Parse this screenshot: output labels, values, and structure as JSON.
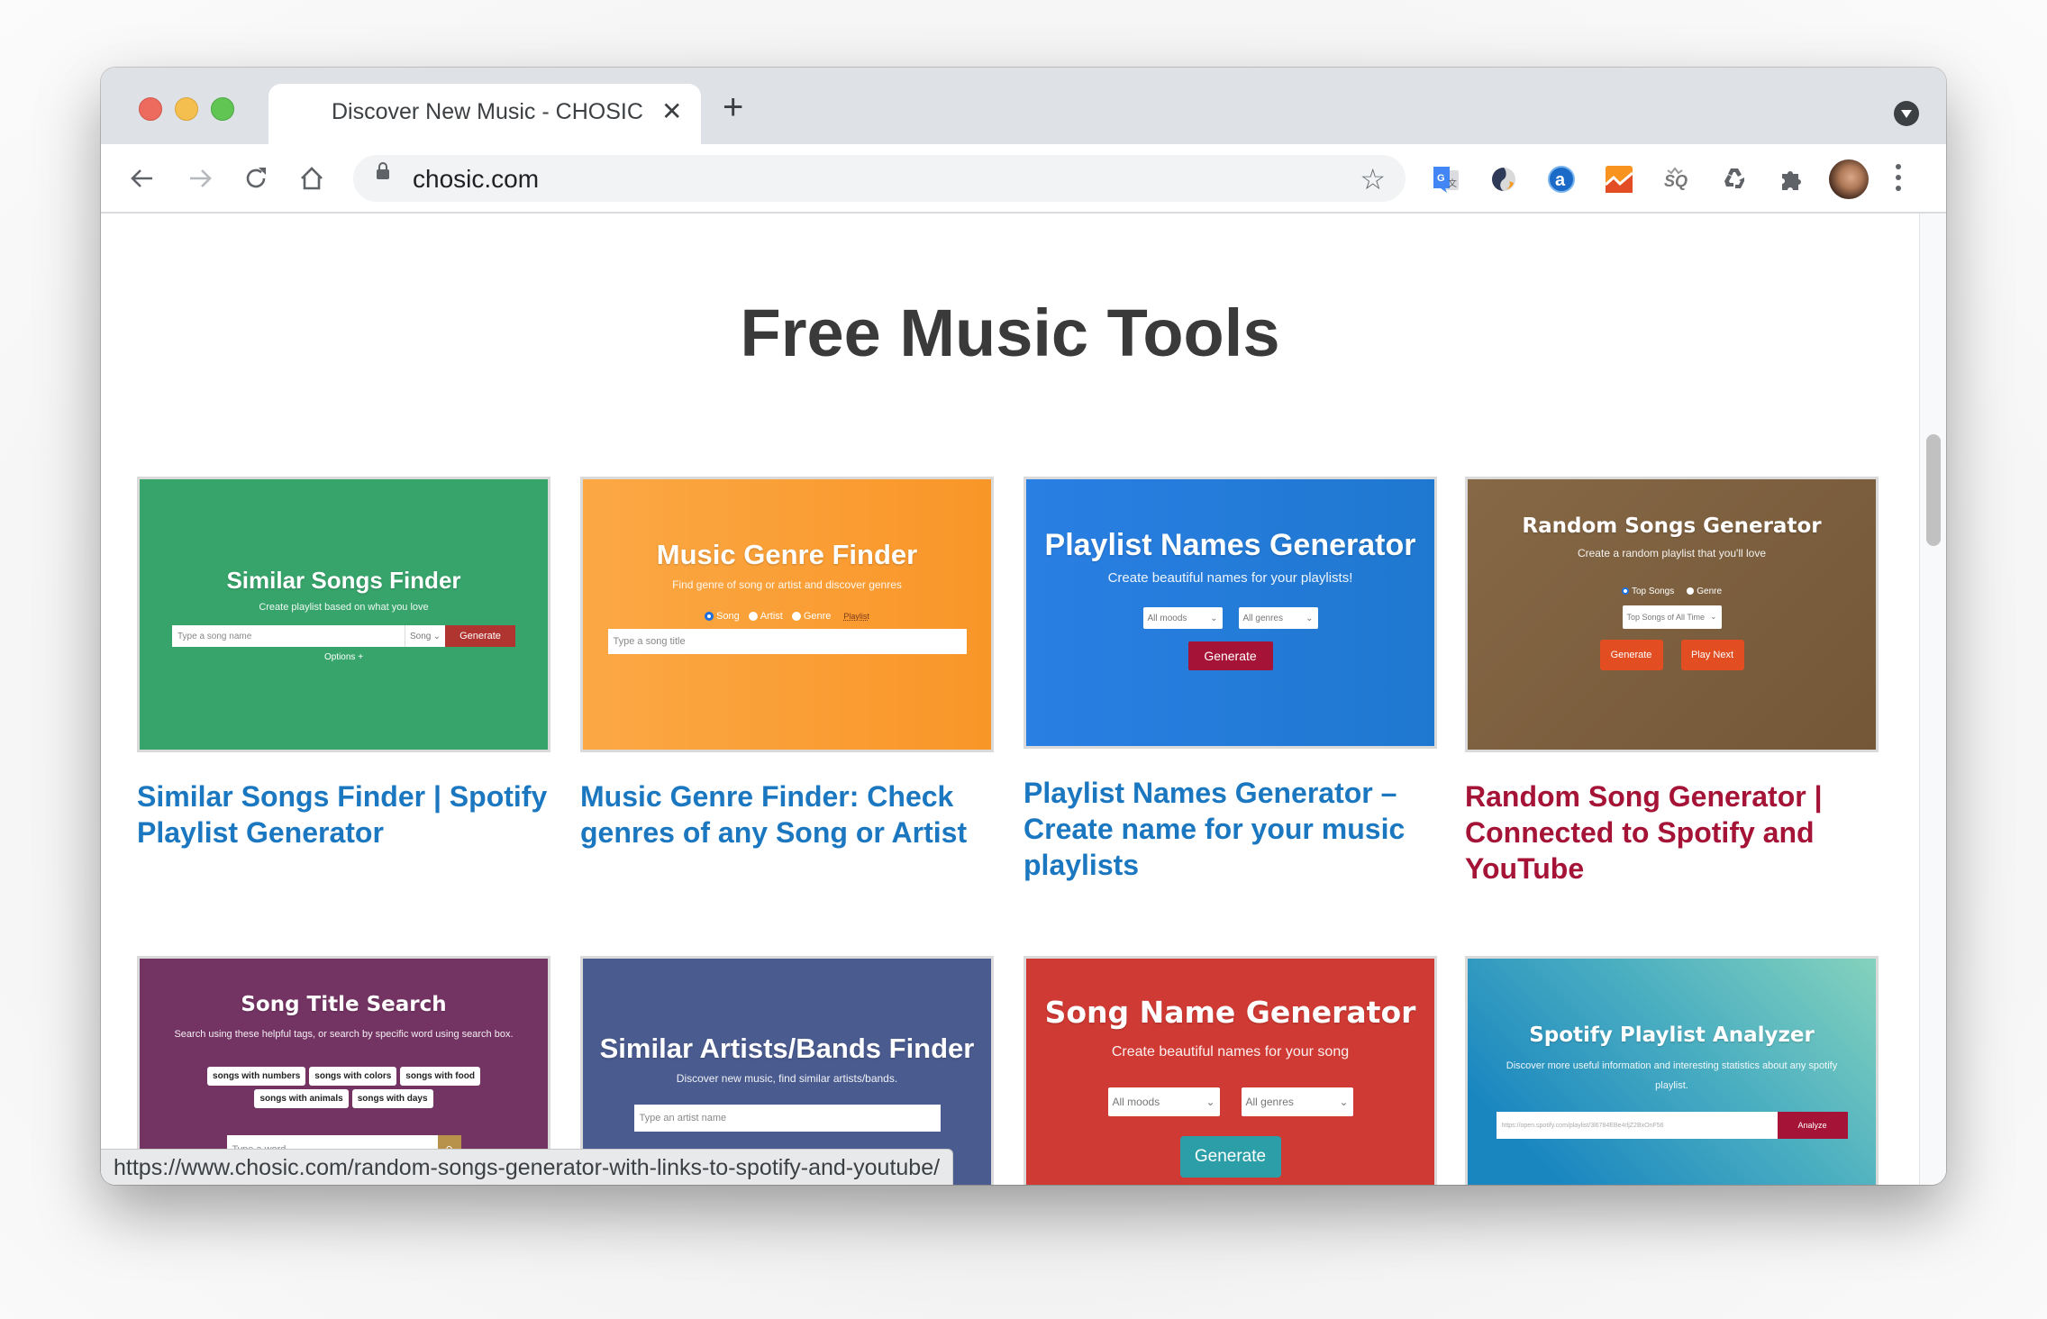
{
  "browser": {
    "tab": {
      "title": "Discover New Music - CHOSIC",
      "close": "✕"
    },
    "new_tab": "+",
    "omnibox": {
      "url": "chosic.com"
    },
    "extensions": [
      "google-translate",
      "simplenote",
      "alexa",
      "analytics",
      "seoquake",
      "recycle",
      "extensions-puzzle"
    ],
    "status_url": "https://www.chosic.com/random-songs-generator-with-links-to-spotify-and-youtube/"
  },
  "page": {
    "heading": "Free Music Tools",
    "cards": [
      {
        "link_title": "Similar Songs Finder | Spotify Playlist Generator",
        "link_color": "#1a77c0",
        "thumb": {
          "bg": "#37a56b",
          "heading": "Similar Songs Finder",
          "subtitle": "Create playlist based on what you love",
          "input_placeholder": "Type a song name",
          "select_value": "Song",
          "button": "Generate",
          "button_color": "#b0342f",
          "options": "Options +"
        }
      },
      {
        "link_title": "Music Genre Finder: Check genres of any Song or Artist",
        "link_color": "#1a77c0",
        "thumb": {
          "bg_from": "#fba845",
          "bg_to": "#f99628",
          "heading": "Music Genre Finder",
          "subtitle": "Find genre of song or artist and discover genres",
          "radios": [
            {
              "label": "Song",
              "checked": true
            },
            {
              "label": "Artist",
              "checked": false
            },
            {
              "label": "Genre",
              "checked": false
            }
          ],
          "playlist_link": "Playlist",
          "input_placeholder": "Type a song title"
        }
      },
      {
        "link_title": "Playlist Names Generator – Create name for your music playlists",
        "link_color": "#1a77c0",
        "thumb": {
          "bg_from": "#2a7fe3",
          "bg_to": "#1f78cf",
          "heading": "Playlist Names Generator",
          "subtitle": "Create beautiful names for your playlists!",
          "select1": "All moods",
          "select2": "All genres",
          "button": "Generate",
          "button_color": "#a51336"
        }
      },
      {
        "link_title": "Random Song Generator | Connected to Spotify and YouTube",
        "link_color": "#a51336",
        "thumb": {
          "bg_from": "#866846",
          "bg_to": "#735737",
          "heading": "Random Songs Generator",
          "subtitle": "Create a random playlist that you'll love",
          "radios": [
            {
              "label": "Top Songs",
              "checked": true
            },
            {
              "label": "Genre",
              "checked": false
            }
          ],
          "select": "Top Songs of All Time",
          "button1": "Generate",
          "button2": "Play Next",
          "button_color": "#e24d22"
        }
      },
      {
        "thumb": {
          "bg": "#743463",
          "heading": "Song Title Search",
          "subtitle": "Search using these helpful tags, or search by specific word using search box.",
          "tags_row1": [
            "songs with numbers",
            "songs with colors",
            "songs with food"
          ],
          "tags_row2": [
            "songs with animals",
            "songs with days"
          ],
          "input_placeholder": "Type a word",
          "search_button_color": "#b8914a"
        }
      },
      {
        "thumb": {
          "bg": "#4a5b8f",
          "heading": "Similar Artists/Bands Finder",
          "subtitle": "Discover new music, find similar artists/bands.",
          "input_placeholder": "Type an artist name"
        }
      },
      {
        "thumb": {
          "bg": "#d03a34",
          "heading": "Song Name Generator",
          "subtitle": "Create beautiful names for your song",
          "select1": "All moods",
          "select2": "All genres",
          "button": "Generate",
          "button_color": "#2c9ea8"
        }
      },
      {
        "thumb": {
          "bg_from": "#1a86c0",
          "bg_to": "#84d2bd",
          "heading": "Spotify Playlist Analyzer",
          "subtitle": "Discover more useful information and interesting statistics about any spotify playlist.",
          "input_placeholder": "https://open.spotify.com/playlist/3l6784EBe4rljZ2BxOnF56",
          "button": "Analyze",
          "button_color": "#a51336"
        }
      }
    ]
  }
}
